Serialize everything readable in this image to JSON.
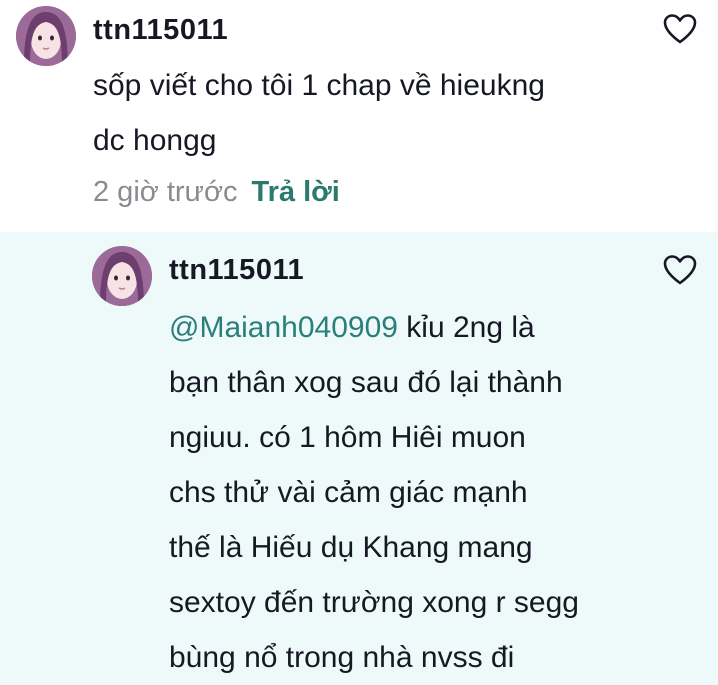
{
  "comments": [
    {
      "username": "ttn115011",
      "text": "sốp viết cho tôi 1 chap về hieukng\ndc hongg",
      "time": "2 giờ trước",
      "reply_label": "Trả lời"
    },
    {
      "username": "ttn115011",
      "mention": "@Maianh040909",
      "text": " kỉu 2ng là\nbạn thân xog sau đó lại thành\nngiuu. có 1 hôm Hiêi muon\nchs thử vài cảm giác mạnh\nthế là Hiếu dụ Khang mang\nsextoy đến trường xong r segg\nbùng nổ trong nhà nvss đi"
    }
  ],
  "colors": {
    "reply_background": "#eefafa",
    "reply_link": "#2a7a6e",
    "mention": "#2a7f7a",
    "meta_text": "#8a8b91"
  },
  "icons": {
    "like": "heart-outline-icon"
  }
}
